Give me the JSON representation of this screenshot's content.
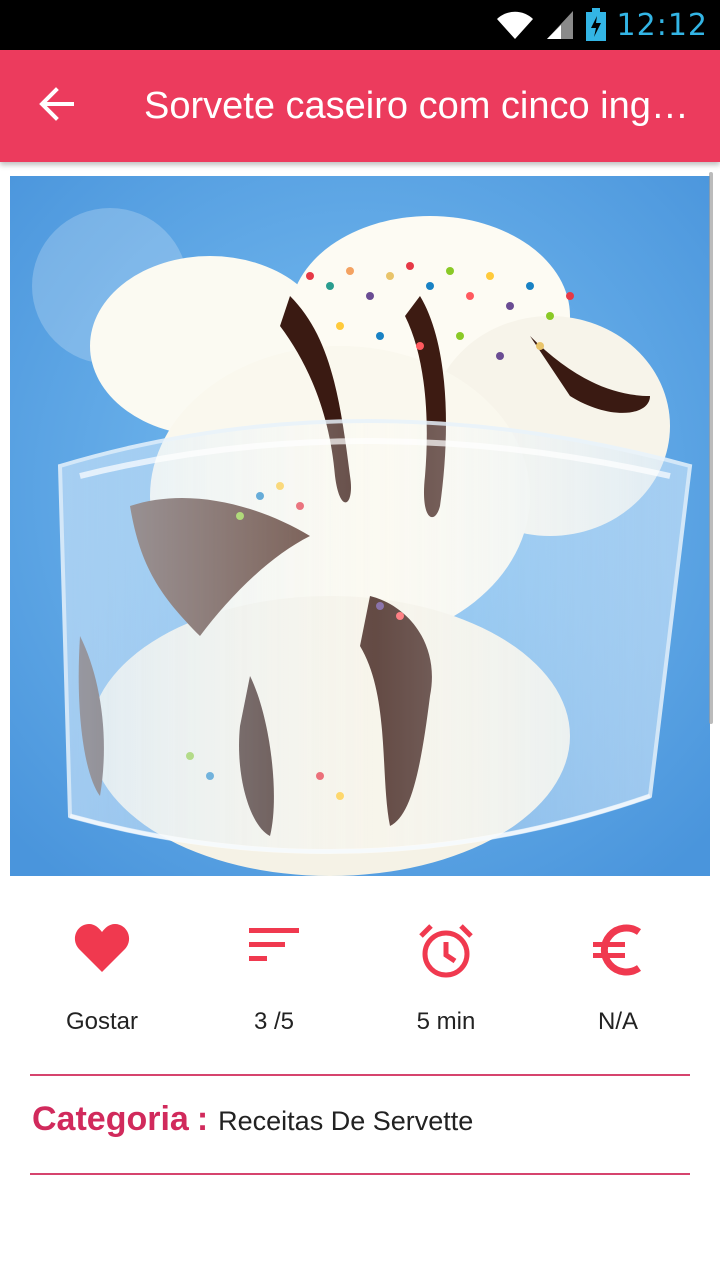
{
  "status_bar": {
    "time": "12:12",
    "icons": [
      "wifi-icon",
      "signal-icon",
      "battery-charging-icon"
    ]
  },
  "app_bar": {
    "title": "Sorvete caseiro com cinco ingredientes",
    "back_icon": "arrow-back-icon"
  },
  "hero_image": {
    "subject": "ice cream sundae with chocolate syrup and sprinkles in a glass"
  },
  "stats": [
    {
      "icon": "heart-icon",
      "label": "Gostar"
    },
    {
      "icon": "difficulty-icon",
      "label": "3 /5"
    },
    {
      "icon": "alarm-clock-icon",
      "label": "5 min"
    },
    {
      "icon": "euro-icon",
      "label": "N/A"
    }
  ],
  "category": {
    "label": "Categoria",
    "colon": ":",
    "value": "Receitas De Servette"
  },
  "colors": {
    "accent": "#ec3b5d",
    "category_label": "#d12a5c",
    "status_text": "#33b5e5"
  }
}
